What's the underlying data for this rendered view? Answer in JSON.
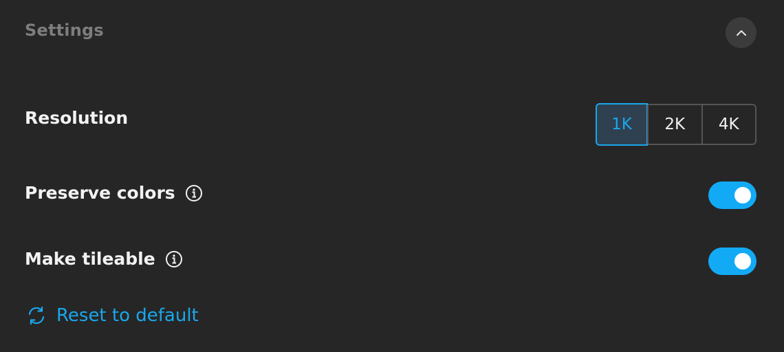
{
  "header": {
    "title": "Settings",
    "collapse_icon": "chevron-up-icon"
  },
  "resolution": {
    "label": "Resolution",
    "options": [
      "1K",
      "2K",
      "4K"
    ],
    "selected": "1K"
  },
  "preserve_colors": {
    "label": "Preserve colors",
    "info_icon": "info-icon",
    "enabled": true
  },
  "make_tileable": {
    "label": "Make tileable",
    "info_icon": "info-icon",
    "enabled": true
  },
  "reset": {
    "label": "Reset to default",
    "icon": "refresh-icon"
  },
  "colors": {
    "background": "#262626",
    "accent": "#13aaf5",
    "text": "#f2f2f2",
    "muted": "#7d7d7d"
  }
}
